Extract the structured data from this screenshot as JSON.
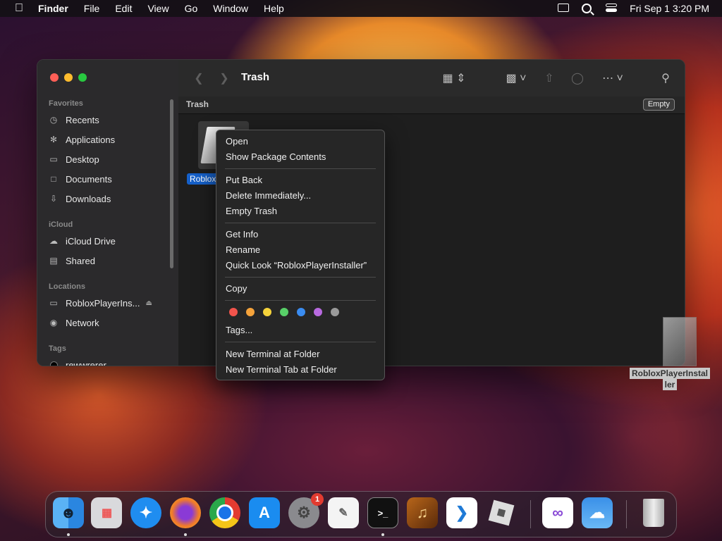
{
  "menubar": {
    "app_name": "Finder",
    "items": [
      "File",
      "Edit",
      "View",
      "Go",
      "Window",
      "Help"
    ],
    "datetime": "Fri Sep 1  3:20 PM",
    "icons": [
      "apple-icon",
      "screen-mirroring-icon",
      "spotlight-icon",
      "control-center-icon"
    ]
  },
  "finder": {
    "title": "Trash",
    "path_label": "Trash",
    "empty_button": "Empty",
    "sidebar": {
      "favorites_title": "Favorites",
      "favorites": [
        "Recents",
        "Applications",
        "Desktop",
        "Documents",
        "Downloads"
      ],
      "icloud_title": "iCloud",
      "icloud": [
        "iCloud Drive",
        "Shared"
      ],
      "locations_title": "Locations",
      "locations": [
        "RobloxPlayerIns...",
        "Network"
      ],
      "tags_title": "Tags",
      "tags": [
        "rewwrerer"
      ]
    },
    "file": {
      "label": "Roblox"
    }
  },
  "context_menu": {
    "items": {
      "open": "Open",
      "show_package": "Show Package Contents",
      "put_back": "Put Back",
      "delete_immediately": "Delete Immediately...",
      "empty_trash": "Empty Trash",
      "get_info": "Get Info",
      "rename": "Rename",
      "quick_look": "Quick Look “RobloxPlayerInstaller”",
      "copy": "Copy",
      "tags": "Tags...",
      "new_terminal": "New Terminal at Folder",
      "new_terminal_tab": "New Terminal Tab at Folder"
    },
    "tag_colors": [
      "#f2544c",
      "#f5a33b",
      "#f5d33b",
      "#58d068",
      "#3a8cf0",
      "#b86ae0",
      "#9a9a9a"
    ]
  },
  "desktop_item": {
    "label_line1": "RobloxPlayerInstal",
    "label_line2": "ler"
  },
  "dock": {
    "apps": [
      "Finder",
      "Launchpad",
      "Safari",
      "Firefox",
      "Chrome",
      "App Store",
      "System Settings",
      "TextEdit",
      "Terminal",
      "GarageBand",
      "Visual Studio Code",
      "Roblox",
      "Visual Studio",
      "Weather",
      "Trash"
    ],
    "settings_badge": "1"
  },
  "colors": {
    "accent": "#1560c9",
    "close": "#ff5f57",
    "minimize": "#febc2e",
    "zoom": "#28c840"
  }
}
